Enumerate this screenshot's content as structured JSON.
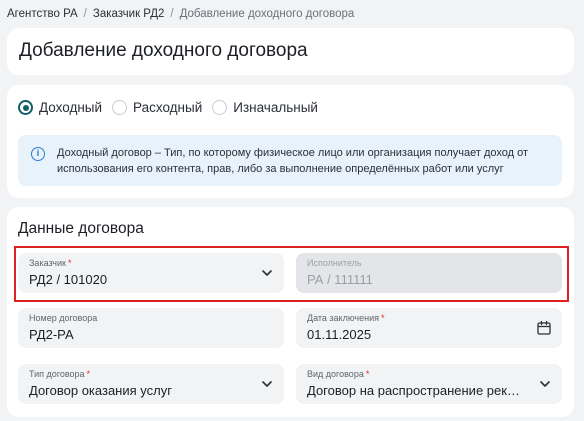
{
  "breadcrumb": [
    "Агентство РА",
    "Заказчик РД2",
    "Добавление доходного договора"
  ],
  "breadcrumb_sep": "/",
  "page_title": "Добавление доходного договора",
  "contract_type": {
    "options": [
      "Доходный",
      "Расходный",
      "Изначальный"
    ],
    "selected": "Доходный"
  },
  "info_text": "Доходный договор – Тип, по которому физическое лицо или организация получает доход от использования его контента, прав, либо за выполнение определённых работ или услуг",
  "section_title": "Данные договора",
  "required_mark": "*",
  "fields": {
    "customer": {
      "label": "Заказчик",
      "value": "РД2 / 101020",
      "required": true
    },
    "executor": {
      "label": "Исполнитель",
      "value": "РА / 111111",
      "disabled": true
    },
    "number": {
      "label": "Номер договора",
      "value": "РД2-РА"
    },
    "date": {
      "label": "Дата заключения",
      "value": "01.11.2025",
      "required": true
    },
    "type": {
      "label": "Тип договора",
      "value": "Договор оказания услуг",
      "required": true
    },
    "kind": {
      "label": "Вид договора",
      "value": "Договор на распространение рек…",
      "required": true
    }
  },
  "colors": {
    "accent": "#0f5e68",
    "info_bg": "#e7f2fb",
    "info_icon": "#2e7bd6",
    "required": "#d62b2b",
    "highlight": "#dd2020"
  },
  "icons": {
    "info": "info-icon",
    "dropdown": "chevron-down-icon",
    "calendar": "calendar-icon"
  }
}
